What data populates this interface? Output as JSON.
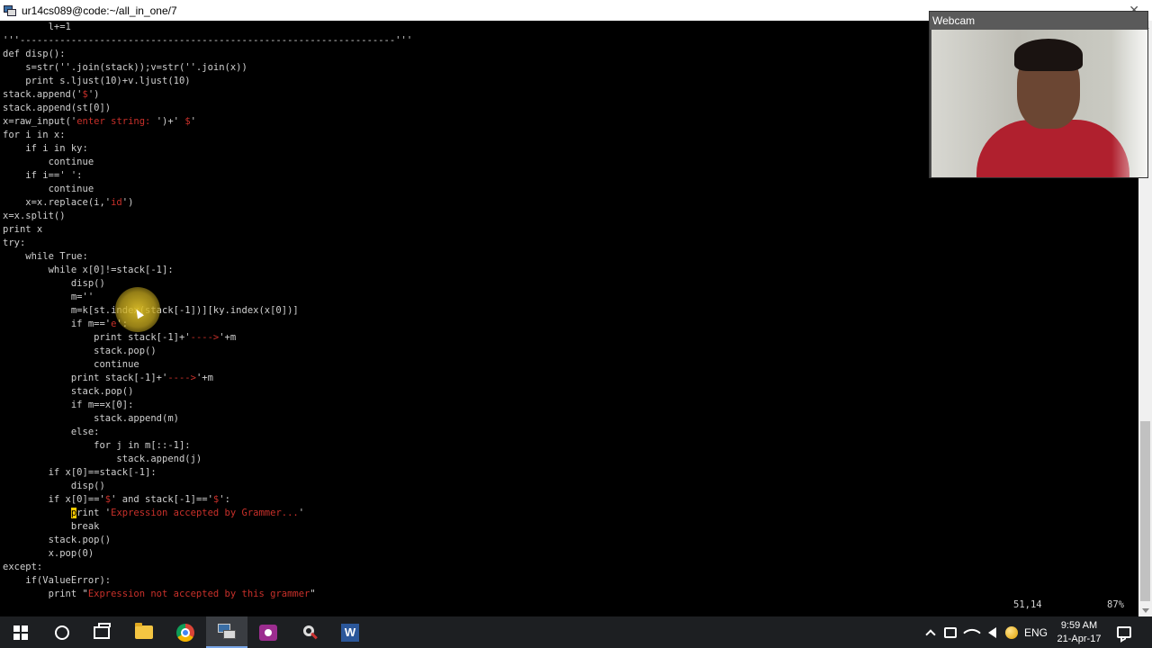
{
  "window": {
    "title": "ur14cs089@code:~/all_in_one/7",
    "minimize_glyph": "—",
    "close_glyph": "✕"
  },
  "terminal": {
    "lines": [
      [
        {
          "t": "        l+=1"
        }
      ],
      [
        {
          "t": "'''------------------------------------------------------------------'''"
        }
      ],
      [
        {
          "t": "def disp():"
        }
      ],
      [
        {
          "t": "    s=str(''.join(stack));v=str(''.join(x))"
        }
      ],
      [
        {
          "t": "    print s.ljust(10)+v.ljust(10)"
        }
      ],
      [
        {
          "t": "stack.append('"
        },
        {
          "t": "$",
          "c": "str"
        },
        {
          "t": "')"
        }
      ],
      [
        {
          "t": "stack.append(st[0])"
        }
      ],
      [
        {
          "t": "x=raw_input('"
        },
        {
          "t": "enter string: ",
          "c": "str"
        },
        {
          "t": "')+' "
        },
        {
          "t": "$",
          "c": "str"
        },
        {
          "t": "'"
        }
      ],
      [
        {
          "t": "for i in x:"
        }
      ],
      [
        {
          "t": "    if i in ky:"
        }
      ],
      [
        {
          "t": "        continue"
        }
      ],
      [
        {
          "t": "    if i==' ':"
        }
      ],
      [
        {
          "t": "        continue"
        }
      ],
      [
        {
          "t": "    x=x.replace(i,'"
        },
        {
          "t": "id",
          "c": "str"
        },
        {
          "t": "')"
        }
      ],
      [
        {
          "t": "x=x.split()"
        }
      ],
      [
        {
          "t": "print x"
        }
      ],
      [
        {
          "t": "try:"
        }
      ],
      [
        {
          "t": "    while True:"
        }
      ],
      [
        {
          "t": "        while x[0]!=stack[-1]:"
        }
      ],
      [
        {
          "t": "            disp()"
        }
      ],
      [
        {
          "t": "            m=''"
        }
      ],
      [
        {
          "t": "            m=k[st.index(stack[-1])][ky.index(x[0])]"
        }
      ],
      [
        {
          "t": "            if m=='"
        },
        {
          "t": "e",
          "c": "str"
        },
        {
          "t": "':"
        }
      ],
      [
        {
          "t": "                print stack[-1]+'"
        },
        {
          "t": "---->",
          "c": "str"
        },
        {
          "t": "'+m"
        }
      ],
      [
        {
          "t": "                stack.pop()"
        }
      ],
      [
        {
          "t": "                continue"
        }
      ],
      [
        {
          "t": "            print stack[-1]+'"
        },
        {
          "t": "---->",
          "c": "str"
        },
        {
          "t": "'+m"
        }
      ],
      [
        {
          "t": "            stack.pop()"
        }
      ],
      [
        {
          "t": "            if m==x[0]:"
        }
      ],
      [
        {
          "t": "                stack.append(m)"
        }
      ],
      [
        {
          "t": "            else:"
        }
      ],
      [
        {
          "t": "                for j in m[::-1]:"
        }
      ],
      [
        {
          "t": "                    stack.append(j)"
        }
      ],
      [
        {
          "t": "        if x[0]==stack[-1]:"
        }
      ],
      [
        {
          "t": "            disp()"
        }
      ],
      [
        {
          "t": "        if x[0]=='"
        },
        {
          "t": "$",
          "c": "str"
        },
        {
          "t": "' and stack[-1]=='"
        },
        {
          "t": "$",
          "c": "str"
        },
        {
          "t": "':"
        }
      ],
      [
        {
          "t": "            "
        },
        {
          "t": "p",
          "c": "cursor"
        },
        {
          "t": "rint '"
        },
        {
          "t": "Expression accepted by Grammer...",
          "c": "str"
        },
        {
          "t": "'"
        }
      ],
      [
        {
          "t": "            break"
        }
      ],
      [
        {
          "t": "        stack.pop()"
        }
      ],
      [
        {
          "t": "        x.pop(0)"
        }
      ],
      [
        {
          "t": "except:"
        }
      ],
      [
        {
          "t": "    if(ValueError):"
        }
      ],
      [
        {
          "t": "        print \""
        },
        {
          "t": "Expression not accepted by this grammer",
          "c": "str"
        },
        {
          "t": "\""
        }
      ]
    ],
    "cursor_position": "51,14",
    "scroll_percent": "87%"
  },
  "webcam": {
    "title": "Webcam"
  },
  "taskbar": {
    "apps": [
      {
        "name": "start-button",
        "icon": "windows-start-icon"
      },
      {
        "name": "cortana-button",
        "icon": "cortana-icon"
      },
      {
        "name": "task-view-button",
        "icon": "task-view-icon"
      },
      {
        "name": "file-explorer-button",
        "icon": "folder-icon"
      },
      {
        "name": "chrome-button",
        "icon": "chrome-icon"
      },
      {
        "name": "putty-button",
        "icon": "putty-icon"
      },
      {
        "name": "screen-recorder-button",
        "icon": "recorder-icon"
      },
      {
        "name": "snipping-tool-button",
        "icon": "tool-icon"
      },
      {
        "name": "word-button",
        "icon": "word-icon"
      }
    ],
    "tray": {
      "language": "ENG",
      "time": "9:59 AM",
      "date": "21-Apr-17"
    },
    "word_letter": "W"
  },
  "colors": {
    "terminal_bg": "#000000",
    "terminal_text": "#d0d0d0",
    "string_literal": "#c8302a",
    "cursor": "#ffcc00",
    "taskbar_bg": "#1d1f22"
  }
}
